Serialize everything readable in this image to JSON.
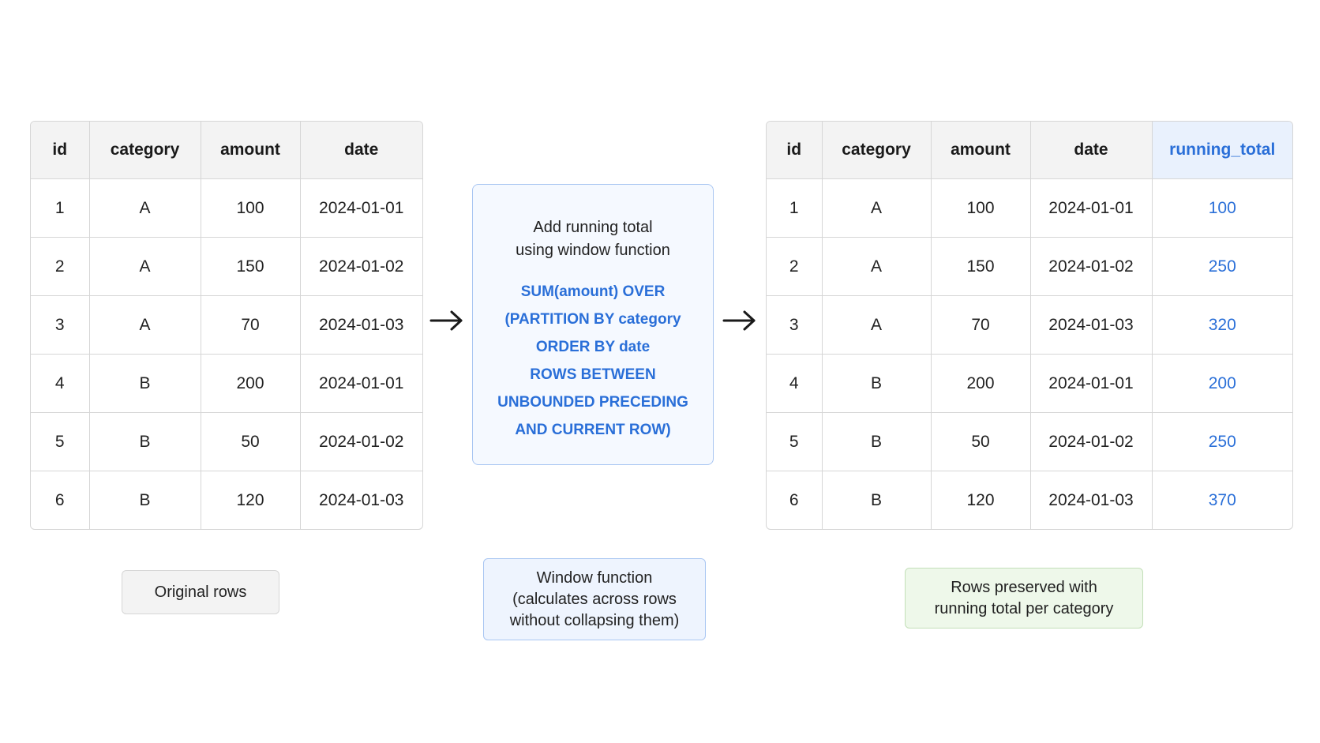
{
  "original_table": {
    "headers": [
      "id",
      "category",
      "amount",
      "date"
    ],
    "rows": [
      [
        "1",
        "A",
        "100",
        "2024-01-01"
      ],
      [
        "2",
        "A",
        "150",
        "2024-01-02"
      ],
      [
        "3",
        "A",
        "70",
        "2024-01-03"
      ],
      [
        "4",
        "B",
        "200",
        "2024-01-01"
      ],
      [
        "5",
        "B",
        "50",
        "2024-01-02"
      ],
      [
        "6",
        "B",
        "120",
        "2024-01-03"
      ]
    ]
  },
  "window_box": {
    "description_line1": "Add running total",
    "description_line2": "using window function",
    "sql_lines": [
      "SUM(amount) OVER",
      "(PARTITION BY category",
      "ORDER BY date",
      "ROWS BETWEEN",
      "UNBOUNDED PRECEDING",
      "AND CURRENT ROW)"
    ]
  },
  "result_table": {
    "headers": [
      "id",
      "category",
      "amount",
      "date",
      "running_total"
    ],
    "rows": [
      [
        "1",
        "A",
        "100",
        "2024-01-01",
        "100"
      ],
      [
        "2",
        "A",
        "150",
        "2024-01-02",
        "250"
      ],
      [
        "3",
        "A",
        "70",
        "2024-01-03",
        "320"
      ],
      [
        "4",
        "B",
        "200",
        "2024-01-01",
        "200"
      ],
      [
        "5",
        "B",
        "50",
        "2024-01-02",
        "250"
      ],
      [
        "6",
        "B",
        "120",
        "2024-01-03",
        "370"
      ]
    ]
  },
  "captions": {
    "original": "Original rows",
    "window_line1": "Window function",
    "window_line2": "(calculates across rows",
    "window_line3": "without collapsing them)",
    "preserved_line1": "Rows preserved with",
    "preserved_line2": "running total per category"
  },
  "icons": {
    "arrow": "arrow-right-icon"
  },
  "colors": {
    "accent_blue": "#2a6fd8",
    "header_gray": "#f3f3f3",
    "running_header_bg": "#e9f1fd",
    "window_box_bg": "#f5f9ff",
    "preserved_bg": "#eef8ea"
  }
}
